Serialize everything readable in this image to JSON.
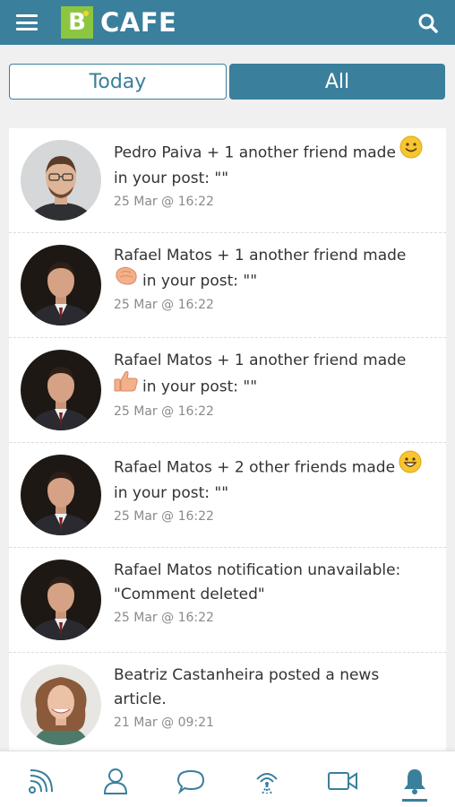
{
  "header": {
    "logo_letter": "B",
    "logo_text": "CAFE",
    "bg_color": "#3a7f9c",
    "logo_color": "#8cc63f",
    "menu_icon": "hamburger-icon",
    "search_icon": "search-icon"
  },
  "tabs": {
    "today_label": "Today",
    "all_label": "All",
    "active": "All"
  },
  "notifications": [
    {
      "line1": "Pedro Paiva + 1 another friend made",
      "line2": "in your post: \"\"",
      "time": "25 Mar @ 16:22",
      "reaction": "smile-emoji"
    },
    {
      "line1": "Rafael Matos + 1 another friend made",
      "line2": "in your post: \"\"",
      "time": "25 Mar @ 16:22",
      "reaction": "clap-emoji"
    },
    {
      "line1": "Rafael Matos + 1 another friend made",
      "line2": "in your post: \"\"",
      "time": "25 Mar @ 16:22",
      "reaction": "thumbs-up-emoji"
    },
    {
      "line1": "Rafael Matos + 2 other friends made",
      "line2": "in your post: \"\"",
      "time": "25 Mar @ 16:22",
      "reaction": "grin-emoji"
    },
    {
      "line1": "Rafael Matos notification unavailable:",
      "line2": "\"Comment deleted\"",
      "time": "25 Mar @ 16:22",
      "reaction": ""
    },
    {
      "line1": "Beatriz Castanheira posted a news",
      "line2": "article.",
      "time": "21 Mar @ 09:21",
      "reaction": ""
    }
  ],
  "bottom_nav": {
    "items": [
      "feed-icon",
      "profile-icon",
      "chat-icon",
      "broadcast-icon",
      "video-icon",
      "bell-icon"
    ],
    "active": "bell-icon",
    "active_color": "#3a7f9c"
  }
}
